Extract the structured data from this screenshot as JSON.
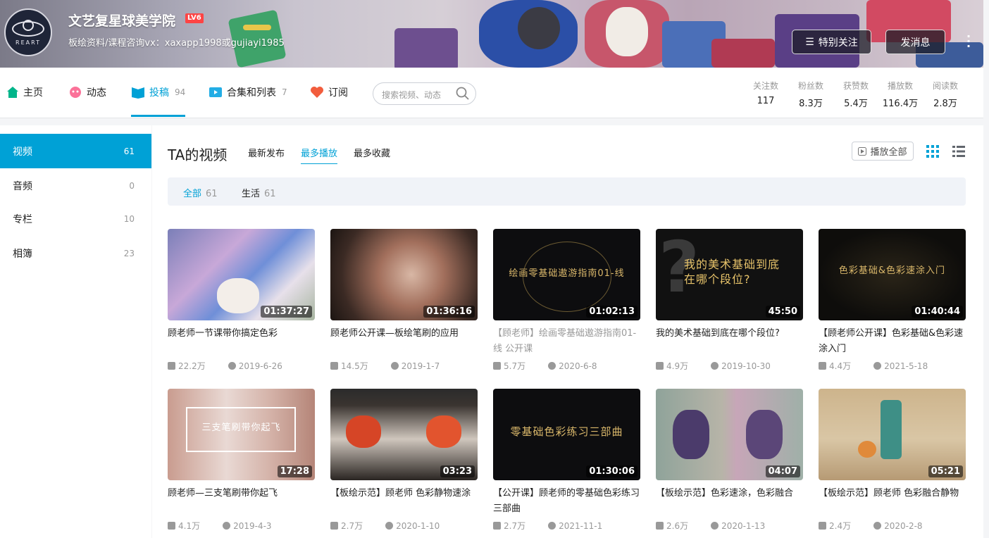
{
  "header": {
    "name": "文艺复星球美学院",
    "level": "LV6",
    "signature": "板绘资料/课程咨询vx：xaxapp1998或gujiayi1985",
    "avatar_text": "REART",
    "follow_btn": "特别关注",
    "message_btn": "发消息"
  },
  "nav": {
    "items": [
      {
        "label": "主页",
        "count": ""
      },
      {
        "label": "动态",
        "count": ""
      },
      {
        "label": "投稿",
        "count": "94"
      },
      {
        "label": "合集和列表",
        "count": "7"
      },
      {
        "label": "订阅",
        "count": ""
      }
    ],
    "search_placeholder": "搜索视频、动态"
  },
  "stats": [
    {
      "label": "关注数",
      "value": "117"
    },
    {
      "label": "粉丝数",
      "value": "8.3万"
    },
    {
      "label": "获赞数",
      "value": "5.4万"
    },
    {
      "label": "播放数",
      "value": "116.4万"
    },
    {
      "label": "阅读数",
      "value": "2.8万"
    }
  ],
  "sidebar": {
    "items": [
      {
        "label": "视频",
        "count": "61"
      },
      {
        "label": "音频",
        "count": "0"
      },
      {
        "label": "专栏",
        "count": "10"
      },
      {
        "label": "相簿",
        "count": "23"
      }
    ]
  },
  "main": {
    "title": "TA的视频",
    "sorts": [
      "最新发布",
      "最多播放",
      "最多收藏"
    ],
    "play_all": "播放全部",
    "filters": [
      {
        "label": "全部",
        "count": "61"
      },
      {
        "label": "生活",
        "count": "61"
      }
    ]
  },
  "videos": [
    {
      "title": "顾老师一节课带你搞定色彩",
      "duration": "01:37:27",
      "plays": "22.2万",
      "date": "2019-6-26",
      "thumb_text": ""
    },
    {
      "title": "顾老师公开课—板绘笔刷的应用",
      "duration": "01:36:16",
      "plays": "14.5万",
      "date": "2019-1-7",
      "thumb_text": ""
    },
    {
      "title": "【顾老师】绘画零基础遨游指南01-线 公开课",
      "duration": "01:02:13",
      "plays": "5.7万",
      "date": "2020-6-8",
      "thumb_text": "绘画零基础遨游指南01-线"
    },
    {
      "title": "我的美术基础到底在哪个段位?",
      "duration": "45:50",
      "plays": "4.9万",
      "date": "2019-10-30",
      "thumb_text": "我的美术基础到底在哪个段位?"
    },
    {
      "title": "【顾老师公开课】色彩基础&色彩速涂入门",
      "duration": "01:40:44",
      "plays": "4.4万",
      "date": "2021-5-18",
      "thumb_text": "色彩基础&色彩速涂入门"
    },
    {
      "title": "顾老师—三支笔刷带你起飞",
      "duration": "17:28",
      "plays": "4.1万",
      "date": "2019-4-3",
      "thumb_text": "三支笔刷带你起飞"
    },
    {
      "title": "【板绘示范】顾老师 色彩静物速涂",
      "duration": "03:23",
      "plays": "2.7万",
      "date": "2020-1-10",
      "thumb_text": ""
    },
    {
      "title": "【公开课】顾老师的零基础色彩练习三部曲",
      "duration": "01:30:06",
      "plays": "2.7万",
      "date": "2021-11-1",
      "thumb_text": "零基础色彩练习三部曲"
    },
    {
      "title": "【板绘示范】色彩速涂，色彩融合",
      "duration": "04:07",
      "plays": "2.6万",
      "date": "2020-1-13",
      "thumb_text": ""
    },
    {
      "title": "【板绘示范】顾老师 色彩融合静物",
      "duration": "05:21",
      "plays": "2.4万",
      "date": "2020-2-8",
      "thumb_text": ""
    }
  ],
  "colors": {
    "accent": "#00a1d6",
    "text": "#222222",
    "muted": "#999999"
  }
}
